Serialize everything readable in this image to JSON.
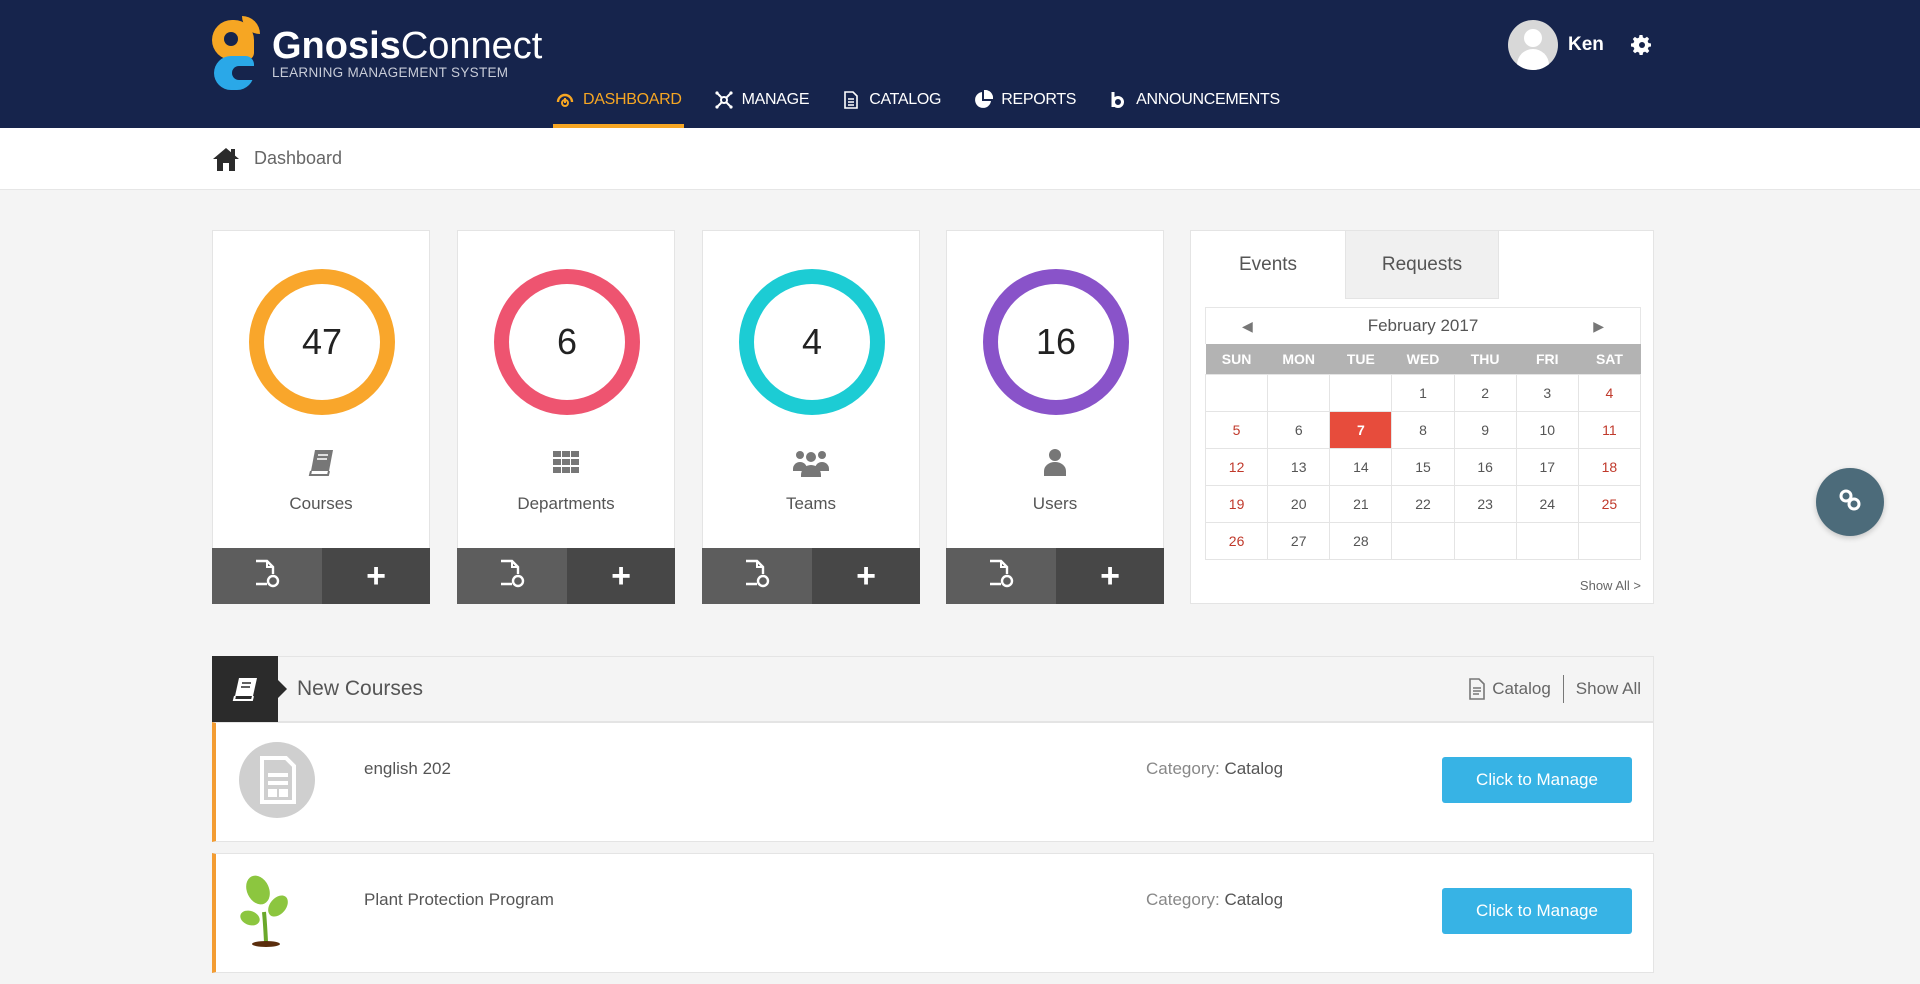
{
  "app": {
    "brand_bold": "Gnosis",
    "brand_light": "Connect",
    "brand_sub": "LEARNING MANAGEMENT SYSTEM"
  },
  "nav": [
    {
      "label": "DASHBOARD",
      "icon": "dashboard-icon",
      "active": true
    },
    {
      "label": "MANAGE",
      "icon": "manage-icon",
      "active": false
    },
    {
      "label": "CATALOG",
      "icon": "catalog-icon",
      "active": false
    },
    {
      "label": "REPORTS",
      "icon": "reports-icon",
      "active": false
    },
    {
      "label": "ANNOUNCEMENTS",
      "icon": "announcements-icon",
      "active": false
    }
  ],
  "user": {
    "name": "Ken"
  },
  "breadcrumb": {
    "label": "Dashboard"
  },
  "stats": [
    {
      "value": "47",
      "label": "Courses",
      "color": "#f9a62b",
      "icon": "book-icon"
    },
    {
      "value": "6",
      "label": "Departments",
      "color": "#ee5470",
      "icon": "grid-icon"
    },
    {
      "value": "4",
      "label": "Teams",
      "color": "#1cccd4",
      "icon": "team-icon"
    },
    {
      "value": "16",
      "label": "Users",
      "color": "#8953c9",
      "icon": "user-icon"
    }
  ],
  "stat_actions": {
    "add_symbol": "+"
  },
  "calendar_widget": {
    "tabs": [
      "Events",
      "Requests"
    ],
    "active_tab": "Events",
    "month": "February 2017",
    "prev": "◀",
    "next": "▶",
    "weekdays": [
      "SUN",
      "MON",
      "TUE",
      "WED",
      "THU",
      "FRI",
      "SAT"
    ],
    "weeks": [
      [
        "",
        "",
        "",
        "1",
        "2",
        "3",
        "4"
      ],
      [
        "5",
        "6",
        "7",
        "8",
        "9",
        "10",
        "11"
      ],
      [
        "12",
        "13",
        "14",
        "15",
        "16",
        "17",
        "18"
      ],
      [
        "19",
        "20",
        "21",
        "22",
        "23",
        "24",
        "25"
      ],
      [
        "26",
        "27",
        "28",
        "",
        "",
        "",
        ""
      ]
    ],
    "today": "7",
    "show_all": "Show All >"
  },
  "new_courses": {
    "title": "New Courses",
    "catalog_link": "Catalog",
    "show_all_link": "Show All",
    "category_label": "Category:",
    "items": [
      {
        "name": "english 202",
        "category": "Catalog",
        "button": "Click to Manage",
        "thumb": "document-thumbnail"
      },
      {
        "name": "Plant Protection Program",
        "category": "Catalog",
        "button": "Click to Manage",
        "thumb": "plant-thumbnail"
      }
    ]
  },
  "colors": {
    "header_bg": "#16244c",
    "accent": "#f6a623",
    "button_blue": "#37b3e5",
    "today_red": "#e74c3c"
  }
}
